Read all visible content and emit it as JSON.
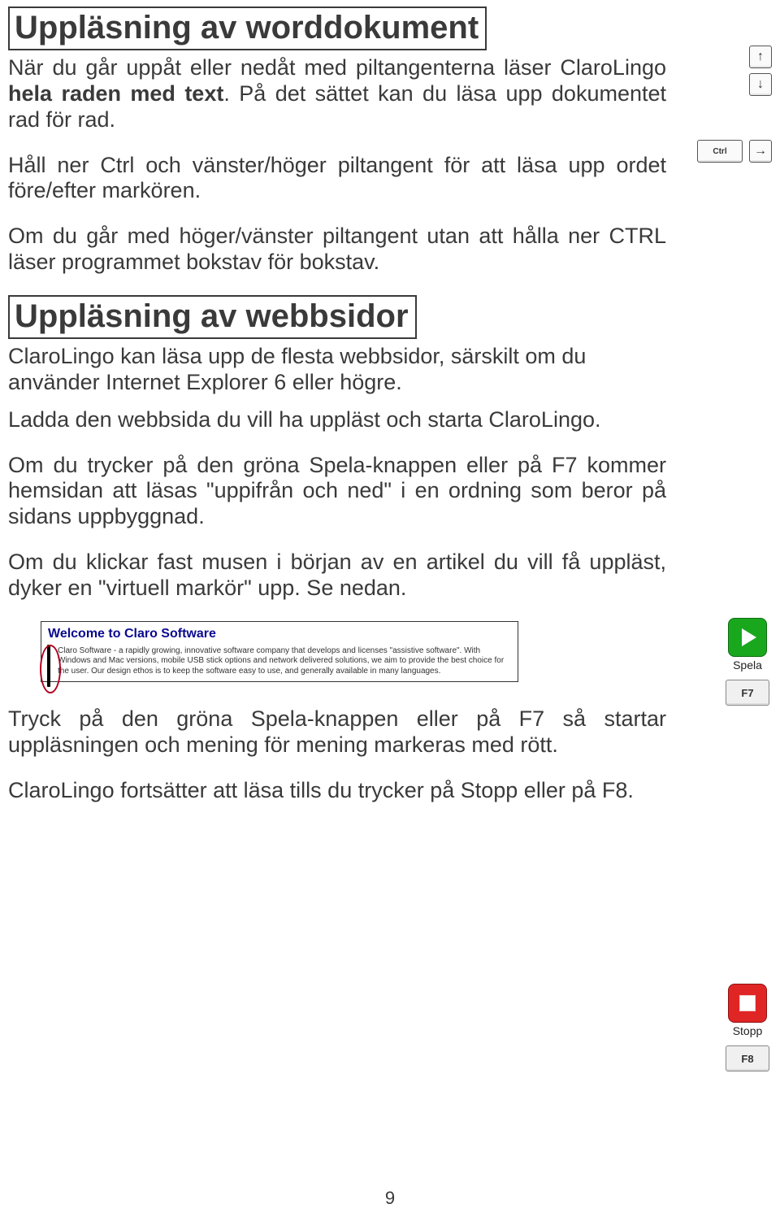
{
  "section1": {
    "heading": "Uppläsning av worddokument",
    "p1": "När du går uppåt eller nedåt med piltangenterna läser Claro­Lingo hela raden med text. På det sättet kan du läsa upp dokumentet rad för rad.",
    "p2": "Håll ner Ctrl och vänster/höger piltangent för att läsa upp or­det före/efter markören.",
    "p3": "Om du går med höger/vänster piltangent utan att hålla ner CTRL läser programmet bokstav för bokstav."
  },
  "section2": {
    "heading": "Uppläsning av webbsidor",
    "p1": "ClaroLingo kan läsa upp de flesta webbsidor, särskilt om du använder Internet Explorer 6 eller högre.",
    "p2": "Ladda den webbsida du vill ha uppläst och starta Claro­Lingo.",
    "p3": "Om du trycker på den gröna Spela-knappen eller på F7 kom­mer hemsidan att läsas \"uppifrån och ned\" i en ordning som beror på sidans uppbyggnad.",
    "p4": "Om du klickar fast musen i början av en artikel du vill få upp­läst, dyker en \"virtuell markör\" upp. Se nedan.",
    "p5": "Tryck på den gröna Spela-knappen eller på F7 så startar uppläsningen och mening för mening markeras med rött.",
    "p6": "ClaroLingo fortsätter att läsa tills du trycker på Stopp eller på F8."
  },
  "keys": {
    "up": "↑",
    "down": "↓",
    "right": "→",
    "ctrl": "Ctrl",
    "f7": "F7",
    "f8": "F8"
  },
  "buttons": {
    "play": "Spela",
    "stop": "Stopp"
  },
  "webshot": {
    "title": "Welcome to Claro Software",
    "body": "Claro Software - a rapidly growing, innovative software company that develops and licenses \"assistive software\". With Windows and Mac versions, mobile USB stick options and network delivered solutions, we aim to provide the best choice for the user. Our design ethos is to keep the software easy to use, and generally available in many languages."
  },
  "pagenum": "9"
}
